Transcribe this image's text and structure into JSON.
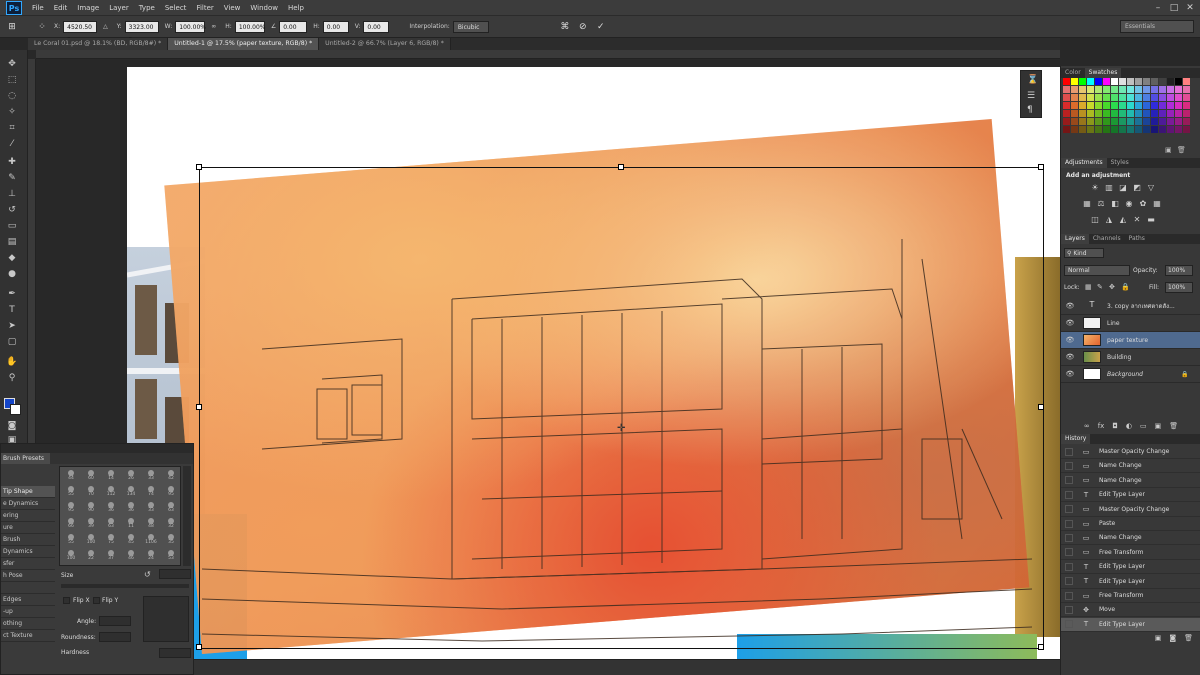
{
  "app": {
    "logo": "Ps",
    "menu": [
      "File",
      "Edit",
      "Image",
      "Layer",
      "Type",
      "Select",
      "Filter",
      "View",
      "Window",
      "Help"
    ]
  },
  "options": {
    "x_label": "X:",
    "x_value": "4520.50 p",
    "y_label": "Y:",
    "y_value": "3323.00 p",
    "w_label": "W:",
    "w_value": "100.00%",
    "h_label": "H:",
    "h_value": "100.00%",
    "angle_value": "0.00",
    "hskew_label": "H:",
    "hskew_value": "0.00",
    "vskew_label": "V:",
    "vskew_value": "0.00",
    "interp_label": "Interpolation:",
    "interp_value": "Bicubic",
    "workspace": "Essentials"
  },
  "tabs": [
    {
      "label": "Le Coral 01.psd @ 18.1% (BD, RGB/8#) *"
    },
    {
      "label": "Untitled-1 @ 17.5% (paper texture, RGB/8) *"
    },
    {
      "label": "Untitled-2 @ 66.7% (Layer 6, RGB/8) *"
    }
  ],
  "brush": {
    "tab": "Brush Presets",
    "options": [
      "Tip Shape",
      "e Dynamics",
      "ering",
      "ure",
      "Brush",
      "Dynamics",
      "sfer",
      "h Pose",
      "",
      "Edges",
      "-up",
      "othing",
      "ct Texture"
    ],
    "cells": [
      [
        "44",
        "60",
        "14",
        "26",
        "33",
        "42"
      ],
      [
        "55",
        "70",
        "112",
        "134",
        "74",
        "95"
      ],
      [
        "95",
        "90",
        "36",
        "36",
        "33",
        "63"
      ],
      [
        "66",
        "39",
        "63",
        "11",
        "48",
        "32"
      ],
      [
        "55",
        "100",
        "75",
        "45",
        "1106",
        "35"
      ],
      [
        "100",
        "22",
        "37",
        "46",
        "24",
        "53"
      ]
    ],
    "size_label": "Size",
    "flipx_label": "Flip X",
    "flipy_label": "Flip Y",
    "angle_label": "Angle:",
    "roundness_label": "Roundness:",
    "hardness_label": "Hardness"
  },
  "panels": {
    "color_tabs": [
      "Color",
      "Swatches"
    ],
    "adjust_tabs": [
      "Adjustments",
      "Styles"
    ],
    "adjust_title": "Add an adjustment",
    "layer_tabs": [
      "Layers",
      "Channels",
      "Paths"
    ],
    "kind": "Kind",
    "blend": "Normal",
    "opacity_label": "Opacity:",
    "opacity_value": "100%",
    "lock_label": "Lock:",
    "fill_label": "Fill:",
    "fill_value": "100%",
    "layers": [
      {
        "name": "3. copy ลากเทศตาดสัง...",
        "type": "text"
      },
      {
        "name": "Line",
        "type": "image"
      },
      {
        "name": "paper texture",
        "type": "image",
        "selected": true
      },
      {
        "name": "Building",
        "type": "image"
      },
      {
        "name": "Background",
        "type": "image"
      }
    ],
    "history_tab": "History",
    "history": [
      {
        "name": "Master Opacity Change",
        "icon": "layer"
      },
      {
        "name": "Name Change",
        "icon": "layer"
      },
      {
        "name": "Name Change",
        "icon": "layer"
      },
      {
        "name": "Edit Type Layer",
        "icon": "type"
      },
      {
        "name": "Master Opacity Change",
        "icon": "layer"
      },
      {
        "name": "Paste",
        "icon": "layer"
      },
      {
        "name": "Name Change",
        "icon": "layer"
      },
      {
        "name": "Free Transform",
        "icon": "layer"
      },
      {
        "name": "Edit Type Layer",
        "icon": "type"
      },
      {
        "name": "Edit Type Layer",
        "icon": "type"
      },
      {
        "name": "Free Transform",
        "icon": "layer"
      },
      {
        "name": "Move",
        "icon": "move"
      },
      {
        "name": "Edit Type Layer",
        "icon": "type"
      }
    ]
  }
}
